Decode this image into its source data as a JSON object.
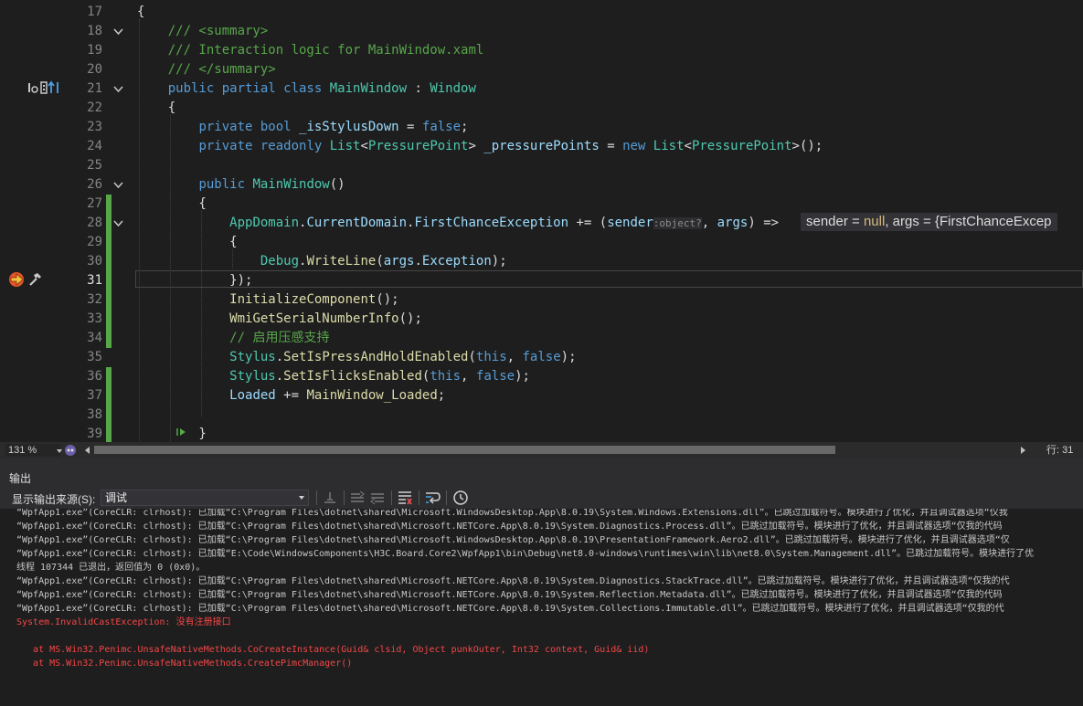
{
  "editor": {
    "lines": [
      {
        "n": "17",
        "fold": false,
        "chg": false,
        "tokens": [
          [
            "p",
            "{"
          ]
        ]
      },
      {
        "n": "18",
        "fold": true,
        "chg": false,
        "tokens": [
          [
            "p",
            "    "
          ],
          [
            "cmt",
            "/// <summary>"
          ]
        ]
      },
      {
        "n": "19",
        "fold": false,
        "chg": false,
        "tokens": [
          [
            "p",
            "    "
          ],
          [
            "cmt",
            "/// Interaction logic for MainWindow.xaml"
          ]
        ]
      },
      {
        "n": "20",
        "fold": false,
        "chg": false,
        "tokens": [
          [
            "p",
            "    "
          ],
          [
            "cmt",
            "/// </summary>"
          ]
        ]
      },
      {
        "n": "21",
        "fold": true,
        "chg": false,
        "tokens": [
          [
            "p",
            "    "
          ],
          [
            "kw",
            "public partial class "
          ],
          [
            "type",
            "MainWindow"
          ],
          [
            "p",
            " : "
          ],
          [
            "type",
            "Window"
          ]
        ]
      },
      {
        "n": "22",
        "fold": false,
        "chg": false,
        "tokens": [
          [
            "p",
            "    {"
          ]
        ]
      },
      {
        "n": "23",
        "fold": false,
        "chg": false,
        "tokens": [
          [
            "p",
            "        "
          ],
          [
            "kw",
            "private bool "
          ],
          [
            "id",
            "_isStylusDown"
          ],
          [
            "p",
            " = "
          ],
          [
            "kw",
            "false"
          ],
          [
            "p",
            ";"
          ]
        ]
      },
      {
        "n": "24",
        "fold": false,
        "chg": false,
        "tokens": [
          [
            "p",
            "        "
          ],
          [
            "kw",
            "private readonly "
          ],
          [
            "type",
            "List"
          ],
          [
            "p",
            "<"
          ],
          [
            "type",
            "PressurePoint"
          ],
          [
            "p",
            "> "
          ],
          [
            "id",
            "_pressurePoints"
          ],
          [
            "p",
            " = "
          ],
          [
            "kw",
            "new "
          ],
          [
            "type",
            "List"
          ],
          [
            "p",
            "<"
          ],
          [
            "type",
            "PressurePoint"
          ],
          [
            "p",
            ">();"
          ]
        ]
      },
      {
        "n": "25",
        "fold": false,
        "chg": false,
        "tokens": []
      },
      {
        "n": "26",
        "fold": true,
        "chg": false,
        "tokens": [
          [
            "p",
            "        "
          ],
          [
            "kw",
            "public "
          ],
          [
            "type",
            "MainWindow"
          ],
          [
            "p",
            "()"
          ]
        ]
      },
      {
        "n": "27",
        "fold": false,
        "chg": true,
        "tokens": [
          [
            "p",
            "        {"
          ]
        ]
      },
      {
        "n": "28",
        "fold": true,
        "chg": true,
        "tokens": [
          [
            "p",
            "            "
          ],
          [
            "type",
            "AppDomain"
          ],
          [
            "p",
            "."
          ],
          [
            "id",
            "CurrentDomain"
          ],
          [
            "p",
            "."
          ],
          [
            "id",
            "FirstChanceException"
          ],
          [
            "p",
            " += ("
          ],
          [
            "id",
            "sender"
          ],
          [
            "hint",
            ":object?"
          ],
          [
            "p",
            ", "
          ],
          [
            "id",
            "args"
          ],
          [
            "p",
            ") =>"
          ]
        ]
      },
      {
        "n": "29",
        "fold": false,
        "chg": true,
        "tokens": [
          [
            "p",
            "            {"
          ]
        ]
      },
      {
        "n": "30",
        "fold": false,
        "chg": true,
        "tokens": [
          [
            "p",
            "                "
          ],
          [
            "type",
            "Debug"
          ],
          [
            "p",
            "."
          ],
          [
            "fn",
            "WriteLine"
          ],
          [
            "p",
            "("
          ],
          [
            "id",
            "args"
          ],
          [
            "p",
            "."
          ],
          [
            "id",
            "Exception"
          ],
          [
            "p",
            ");"
          ]
        ]
      },
      {
        "n": "31",
        "fold": false,
        "chg": true,
        "tokens": [
          [
            "p",
            "            });"
          ]
        ]
      },
      {
        "n": "32",
        "fold": false,
        "chg": true,
        "tokens": [
          [
            "p",
            "            "
          ],
          [
            "fn",
            "InitializeComponent"
          ],
          [
            "p",
            "();"
          ]
        ]
      },
      {
        "n": "33",
        "fold": false,
        "chg": true,
        "tokens": [
          [
            "p",
            "            "
          ],
          [
            "fn",
            "WmiGetSerialNumberInfo"
          ],
          [
            "p",
            "();"
          ]
        ]
      },
      {
        "n": "34",
        "fold": false,
        "chg": true,
        "tokens": [
          [
            "p",
            "            "
          ],
          [
            "cmt",
            "// 启用压感支持"
          ]
        ]
      },
      {
        "n": "35",
        "fold": false,
        "chg": false,
        "tokens": [
          [
            "p",
            "            "
          ],
          [
            "type",
            "Stylus"
          ],
          [
            "p",
            "."
          ],
          [
            "fn",
            "SetIsPressAndHoldEnabled"
          ],
          [
            "p",
            "("
          ],
          [
            "kw",
            "this"
          ],
          [
            "p",
            ", "
          ],
          [
            "kw",
            "false"
          ],
          [
            "p",
            ");"
          ]
        ]
      },
      {
        "n": "36",
        "fold": false,
        "chg": true,
        "tokens": [
          [
            "p",
            "            "
          ],
          [
            "type",
            "Stylus"
          ],
          [
            "p",
            "."
          ],
          [
            "fn",
            "SetIsFlicksEnabled"
          ],
          [
            "p",
            "("
          ],
          [
            "kw",
            "this"
          ],
          [
            "p",
            ", "
          ],
          [
            "kw",
            "false"
          ],
          [
            "p",
            ");"
          ]
        ]
      },
      {
        "n": "37",
        "fold": false,
        "chg": true,
        "tokens": [
          [
            "p",
            "            "
          ],
          [
            "id",
            "Loaded"
          ],
          [
            "p",
            " += "
          ],
          [
            "fn",
            "MainWindow_Loaded"
          ],
          [
            "p",
            ";"
          ]
        ]
      },
      {
        "n": "38",
        "fold": false,
        "chg": true,
        "tokens": []
      },
      {
        "n": "39",
        "fold": false,
        "chg": true,
        "tokens": [
          [
            "p",
            "        }"
          ]
        ]
      }
    ],
    "current_line": "31",
    "datatip": {
      "sender_label": "sender = ",
      "sender_val": "null",
      "sep": ",  ",
      "args_label": "args = ",
      "args_val": "{FirstChanceExcep"
    }
  },
  "status": {
    "zoom": "131 %",
    "position": "行: 31"
  },
  "output": {
    "title": "输出",
    "source_label": "显示输出来源(S):",
    "source_value": "调试",
    "lines": [
      {
        "err": false,
        "text": "“WpfApp1.exe”(CoreCLR: clrhost): 已加载“C:\\Program Files\\dotnet\\shared\\Microsoft.WindowsDesktop.App\\8.0.19\\System.Windows.Extensions.dll”。已跳过加载符号。模块进行了优化，并且调试器选项“仅我"
      },
      {
        "err": false,
        "text": "“WpfApp1.exe”(CoreCLR: clrhost): 已加载“C:\\Program Files\\dotnet\\shared\\Microsoft.NETCore.App\\8.0.19\\System.Diagnostics.Process.dll”。已跳过加载符号。模块进行了优化，并且调试器选项“仅我的代码"
      },
      {
        "err": false,
        "text": "“WpfApp1.exe”(CoreCLR: clrhost): 已加载“C:\\Program Files\\dotnet\\shared\\Microsoft.WindowsDesktop.App\\8.0.19\\PresentationFramework.Aero2.dll”。已跳过加载符号。模块进行了优化，并且调试器选项“仅"
      },
      {
        "err": false,
        "text": "“WpfApp1.exe”(CoreCLR: clrhost): 已加载“E:\\Code\\WindowsComponents\\H3C.Board.Core2\\WpfApp1\\bin\\Debug\\net8.0-windows\\runtimes\\win\\lib\\net8.0\\System.Management.dll”。已跳过加载符号。模块进行了优"
      },
      {
        "err": false,
        "text": "线程 107344 已退出，返回值为 0 (0x0)。"
      },
      {
        "err": false,
        "text": "“WpfApp1.exe”(CoreCLR: clrhost): 已加载“C:\\Program Files\\dotnet\\shared\\Microsoft.NETCore.App\\8.0.19\\System.Diagnostics.StackTrace.dll”。已跳过加载符号。模块进行了优化，并且调试器选项“仅我的代"
      },
      {
        "err": false,
        "text": "“WpfApp1.exe”(CoreCLR: clrhost): 已加载“C:\\Program Files\\dotnet\\shared\\Microsoft.NETCore.App\\8.0.19\\System.Reflection.Metadata.dll”。已跳过加载符号。模块进行了优化，并且调试器选项“仅我的代码"
      },
      {
        "err": false,
        "text": "“WpfApp1.exe”(CoreCLR: clrhost): 已加载“C:\\Program Files\\dotnet\\shared\\Microsoft.NETCore.App\\8.0.19\\System.Collections.Immutable.dll”。已跳过加载符号。模块进行了优化，并且调试器选项“仅我的代"
      },
      {
        "err": true,
        "text": "System.InvalidCastException: 没有注册接口"
      },
      {
        "err": true,
        "text": ""
      },
      {
        "err": true,
        "text": "   at MS.Win32.Penimc.UnsafeNativeMethods.CoCreateInstance(Guid& clsid, Object punkOuter, Int32 context, Guid& iid)"
      },
      {
        "err": true,
        "text": "   at MS.Win32.Penimc.UnsafeNativeMethods.CreatePimcManager()"
      }
    ]
  },
  "colors": {
    "background": "#1e1e1e",
    "keyword": "#569cd6",
    "type": "#4ec9b0",
    "comment": "#57a64a",
    "method": "#dcdcaa",
    "error": "#f44747",
    "change_bar": "#57a64a"
  }
}
